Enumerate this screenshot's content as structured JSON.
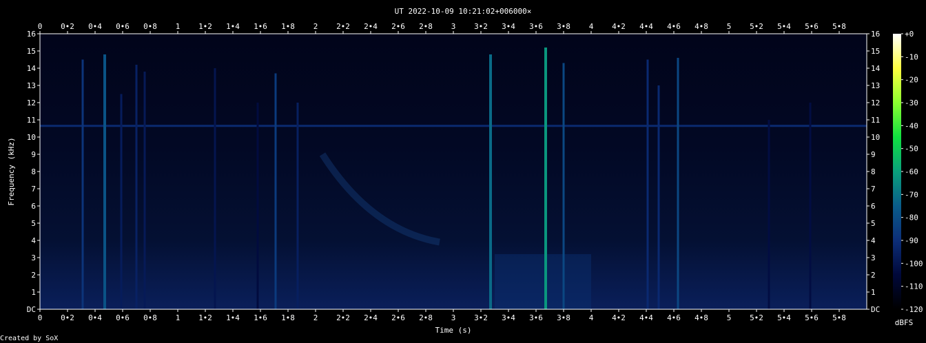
{
  "chart_data": {
    "type": "heatmap",
    "title": "UT 2022-10-09 10:21:02+006000×",
    "xlabel": "Time (s)",
    "ylabel": "Frequency (kHz)",
    "xlim": [
      0,
      5.98
    ],
    "ylim": [
      0,
      16
    ],
    "x_ticks": [
      "0",
      "0•2",
      "0•4",
      "0•6",
      "0•8",
      "1",
      "1•2",
      "1•4",
      "1•6",
      "1•8",
      "2",
      "2•2",
      "2•4",
      "2•6",
      "2•8",
      "3",
      "3•2",
      "3•4",
      "3•6",
      "3•8",
      "4",
      "4•2",
      "4•4",
      "4•6",
      "4•8",
      "5",
      "5•2",
      "5•4",
      "5•6",
      "5•8"
    ],
    "y_ticks": [
      "DC",
      "1",
      "2",
      "3",
      "4",
      "5",
      "6",
      "7",
      "8",
      "9",
      "10",
      "11",
      "12",
      "13",
      "14",
      "15",
      "16"
    ],
    "colorbar": {
      "label": "dBFS",
      "ticks": [
        "+0",
        "-10",
        "-20",
        "-30",
        "-40",
        "-50",
        "-60",
        "-70",
        "-80",
        "-90",
        "-100",
        "-110",
        "-120"
      ],
      "range": [
        -120,
        0
      ]
    },
    "features": {
      "carrier_line": {
        "freq_khz": 10.65,
        "level_dbfs": -90
      },
      "vertical_bursts": [
        {
          "t": 0.31,
          "fmax": 14.5,
          "level_dbfs": -88
        },
        {
          "t": 0.47,
          "fmax": 14.8,
          "level_dbfs": -78
        },
        {
          "t": 0.59,
          "fmax": 12.5,
          "level_dbfs": -97
        },
        {
          "t": 0.7,
          "fmax": 14.2,
          "level_dbfs": -95
        },
        {
          "t": 0.76,
          "fmax": 13.8,
          "level_dbfs": -98
        },
        {
          "t": 1.27,
          "fmax": 14.0,
          "level_dbfs": -100
        },
        {
          "t": 1.58,
          "fmax": 12.0,
          "level_dbfs": -104
        },
        {
          "t": 1.71,
          "fmax": 13.7,
          "level_dbfs": -86
        },
        {
          "t": 1.87,
          "fmax": 12.0,
          "level_dbfs": -96
        },
        {
          "t": 3.27,
          "fmax": 14.8,
          "level_dbfs": -72
        },
        {
          "t": 3.67,
          "fmax": 15.2,
          "level_dbfs": -62
        },
        {
          "t": 3.8,
          "fmax": 14.3,
          "level_dbfs": -82
        },
        {
          "t": 4.41,
          "fmax": 14.5,
          "level_dbfs": -92
        },
        {
          "t": 4.49,
          "fmax": 13.0,
          "level_dbfs": -92
        },
        {
          "t": 4.63,
          "fmax": 14.6,
          "level_dbfs": -82
        },
        {
          "t": 5.29,
          "fmax": 11.0,
          "level_dbfs": -103
        },
        {
          "t": 5.59,
          "fmax": 12.0,
          "level_dbfs": -103
        }
      ],
      "sweep": {
        "t_start": 2.05,
        "f_start_khz": 9.0,
        "t_end": 2.9,
        "f_end_khz": 3.9
      },
      "low_band_block": {
        "t_start": 3.3,
        "t_end": 4.0,
        "fmax_khz": 3.2
      }
    }
  },
  "footer": {
    "credit": "Created by SoX"
  },
  "colors": {
    "background": "#000000",
    "text": "#ffffff",
    "colormap": [
      "#000000",
      "#00083a",
      "#0c2e78",
      "#0a5c8a",
      "#0aa07c",
      "#10e040",
      "#8cff30",
      "#ffff40",
      "#ffffff"
    ]
  }
}
